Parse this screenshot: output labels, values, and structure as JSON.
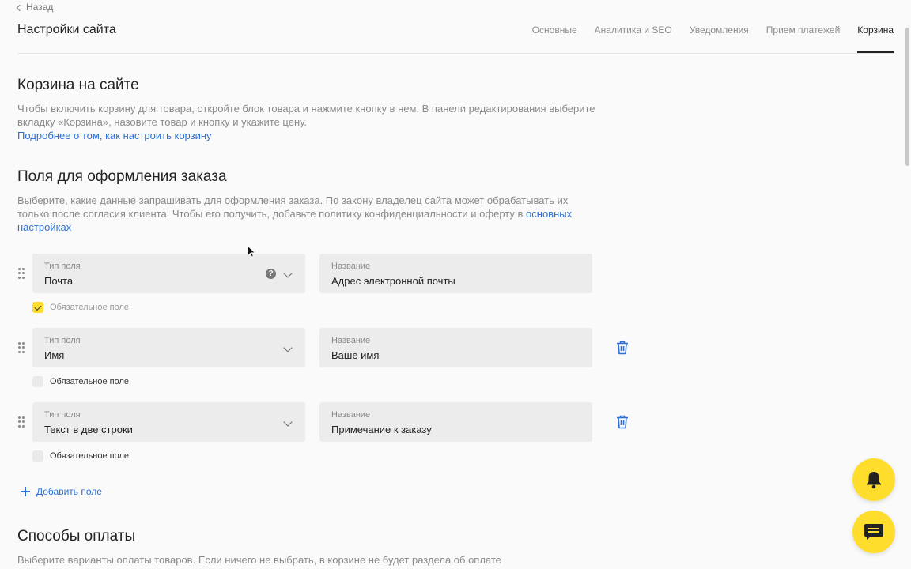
{
  "header": {
    "back_label": "Назад",
    "title": "Настройки сайта",
    "tabs": [
      {
        "label": "Основные"
      },
      {
        "label": "Аналитика и SEO"
      },
      {
        "label": "Уведомления"
      },
      {
        "label": "Прием платежей"
      },
      {
        "label": "Корзина",
        "active": true
      }
    ]
  },
  "cart_section": {
    "title": "Корзина на сайте",
    "description": "Чтобы включить корзину для товара, откройте блок товара и нажмите кнопку в нем. В панели редактирования выберите вкладку «Корзина», назовите товар и кнопку и укажите цену.",
    "link": "Подробнее о том, как настроить корзину"
  },
  "order_fields_section": {
    "title": "Поля для оформления заказа",
    "description": "Выберите, какие данные запрашивать для оформления заказа. По закону владелец сайта может обрабатывать их только после согласия клиента. Чтобы его получить, добавьте политику конфиденциальности и оферту в",
    "link": "основных настройках",
    "fields": [
      {
        "type_label": "Тип поля",
        "type_value": "Почта",
        "name_label": "Название",
        "name_value": "Адрес электронной почты",
        "required_label": "Обязательное поле",
        "required": true
      },
      {
        "type_label": "Тип поля",
        "type_value": "Имя",
        "name_label": "Название",
        "name_value": "Ваше имя",
        "required_label": "Обязательное поле",
        "required": false
      },
      {
        "type_label": "Тип поля",
        "type_value": "Текст в две строки",
        "name_label": "Название",
        "name_value": "Примечание к заказу",
        "required_label": "Обязательное поле",
        "required": false
      }
    ],
    "add_field_label": "Добавить поле"
  },
  "payment_section": {
    "title": "Способы оплаты",
    "description": "Выберите варианты оплаты товаров. Если ничего не выбрать, в корзине не будет раздела об оплате"
  },
  "icons": {
    "help": "help-icon",
    "trash": "trash-icon",
    "bell": "bell-icon",
    "chat": "chat-icon"
  },
  "colors": {
    "accent": "#ffdd2d",
    "link": "#2e6fd1"
  }
}
